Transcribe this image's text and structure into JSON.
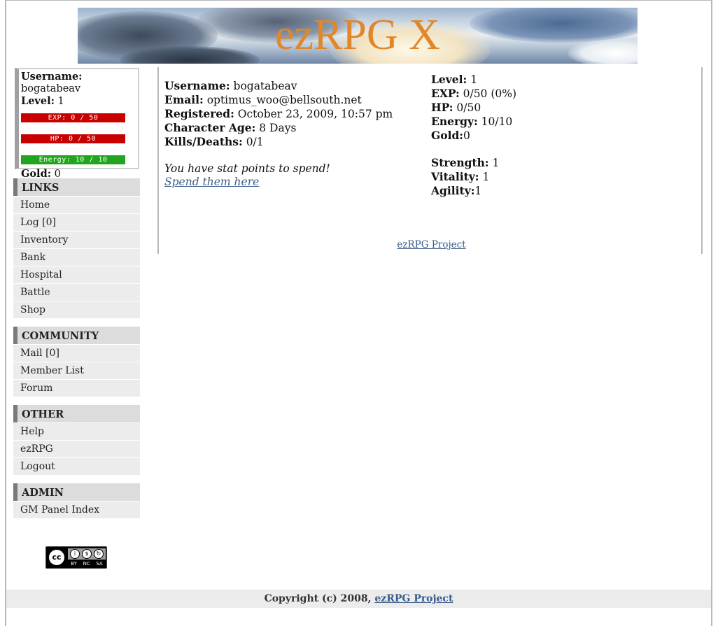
{
  "header": {
    "title": "ezRPG X"
  },
  "status_box": {
    "username_label": "Username:",
    "username": "bogatabeav",
    "level_label": "Level:",
    "level": "1",
    "exp_bar": "EXP: 0 / 50",
    "hp_bar": "HP: 0 / 50",
    "energy_bar": "Energy: 10 / 10",
    "gold_label": "Gold:",
    "gold": "0"
  },
  "menus": {
    "links": {
      "heading": "LINKS",
      "items": [
        "Home",
        "Log [0]",
        "Inventory",
        "Bank",
        "Hospital",
        "Battle",
        "Shop"
      ]
    },
    "community": {
      "heading": "COMMUNITY",
      "items": [
        "Mail [0]",
        "Member List",
        "Forum"
      ]
    },
    "other": {
      "heading": "OTHER",
      "items": [
        "Help",
        "ezRPG",
        "Logout"
      ]
    },
    "admin": {
      "heading": "ADMIN",
      "items": [
        "GM Panel Index"
      ]
    }
  },
  "badge": {
    "cc": "cc",
    "by": "BY",
    "nc": "NC",
    "sa": "SA"
  },
  "profile": {
    "username_label": "Username:",
    "username": "bogatabeav",
    "email_label": "Email:",
    "email": "optimus_woo@bellsouth.net",
    "registered_label": "Registered:",
    "registered": "October 23, 2009, 10:57 pm",
    "age_label": "Character Age:",
    "age": "8 Days",
    "kd_label": "Kills/Deaths:",
    "kd": "0/1",
    "stat_message": "You have stat points to spend!",
    "stat_link": "Spend them here"
  },
  "stats": {
    "level_label": "Level:",
    "level": "1",
    "exp_label": "EXP:",
    "exp": "0/50 (0%)",
    "hp_label": "HP:",
    "hp": "0/50",
    "energy_label": "Energy:",
    "energy": "10/10",
    "gold_label": "Gold:",
    "gold": "0",
    "strength_label": "Strength:",
    "strength": "1",
    "vitality_label": "Vitality:",
    "vitality": "1",
    "agility_label": "Agility:",
    "agility": "1"
  },
  "footer": {
    "project_link": "ezRPG Project",
    "copyright": "Copyright (c) 2008,",
    "copyright_link": "ezRPG Project"
  }
}
